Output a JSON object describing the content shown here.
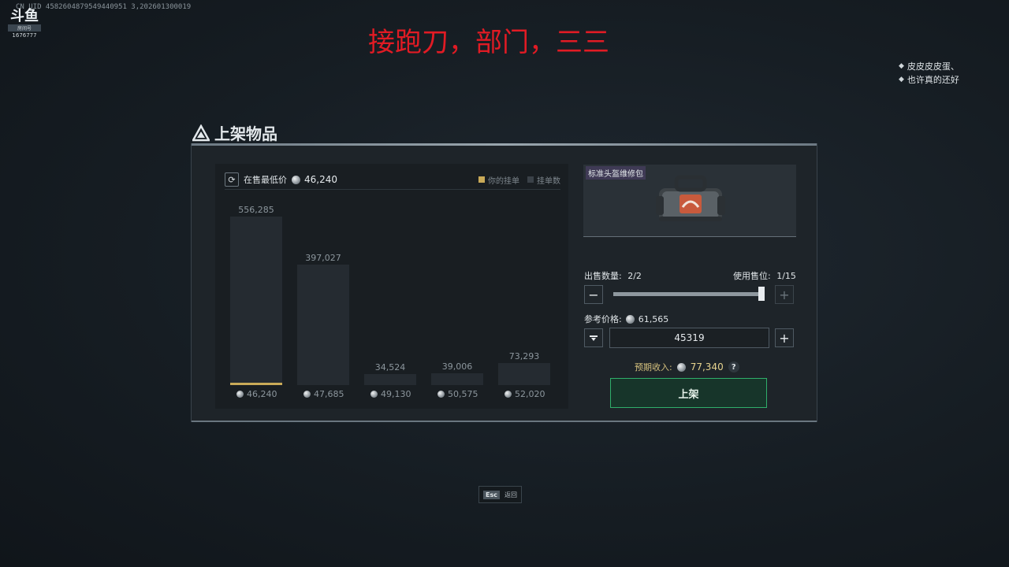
{
  "stream": {
    "uid": "CN UID 4582604879549440951 3,202601300019",
    "logo": "斗鱼",
    "logo_sub": "房间号",
    "room": "1676777",
    "overlay_title": "接跑刀，部门，三三"
  },
  "chat": [
    {
      "icon": "chat-bullet-icon",
      "text": "皮皮皮皮蛋、"
    },
    {
      "icon": "chat-bullet-icon",
      "text": "也许真的还好"
    }
  ],
  "panel": {
    "title": "上架物品"
  },
  "market": {
    "min_price_label": "在售最低价",
    "min_price": "46,240",
    "legend_mine": "你的挂单",
    "legend_count": "挂单数",
    "colors": {
      "mine": "#c9aa58",
      "count": "#3a4148"
    }
  },
  "chart_data": {
    "type": "bar",
    "title": "",
    "categories": [
      "46,240",
      "47,685",
      "49,130",
      "50,575",
      "52,020"
    ],
    "values": [
      556285,
      397027,
      34524,
      39006,
      73293
    ],
    "value_labels": [
      "556,285",
      "397,027",
      "34,524",
      "39,006",
      "73,293"
    ],
    "my_listing_category": "46,240"
  },
  "item": {
    "name": "标准头盔维修包",
    "icon": "repair-bag-icon"
  },
  "sell": {
    "qty_label": "出售数量:",
    "qty_value": "2/2",
    "slots_label": "使用售位:",
    "slots_value": "1/15",
    "qty_fraction": 1.0,
    "ref_label": "参考价格:",
    "ref_value": "61,565",
    "price_input": "45319",
    "expected_label": "预期收入:",
    "expected_value": "77,340",
    "help": "?",
    "submit": "上架"
  },
  "footer": {
    "key": "Esc",
    "label": "返回"
  }
}
